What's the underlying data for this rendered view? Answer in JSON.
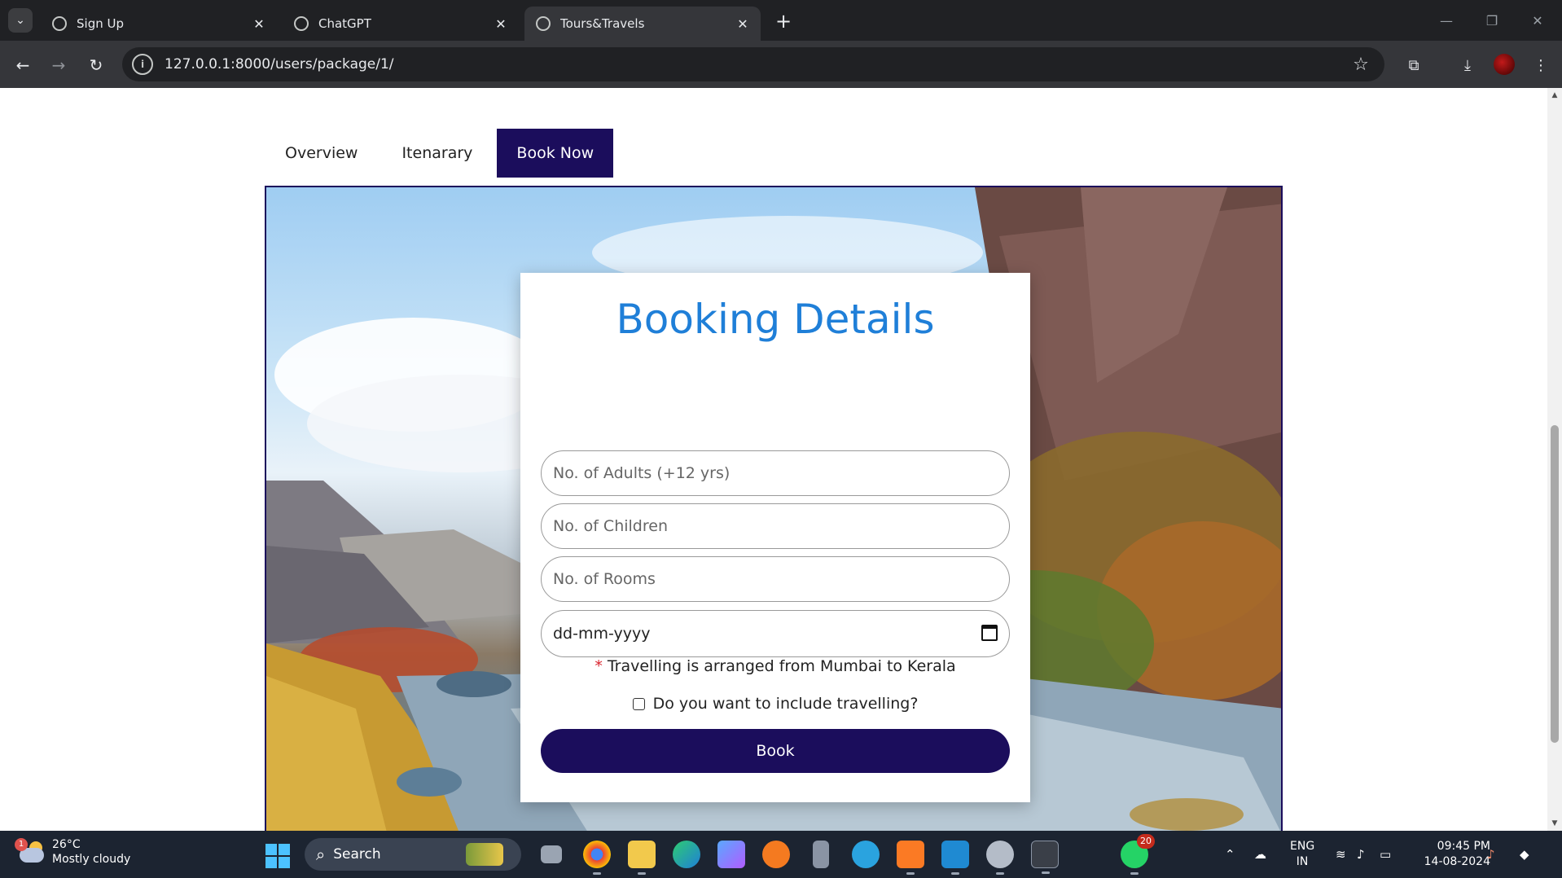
{
  "browser": {
    "tabs": [
      {
        "title": "Sign Up",
        "active": false
      },
      {
        "title": "ChatGPT",
        "active": false
      },
      {
        "title": "Tours&Travels",
        "active": true
      }
    ],
    "new_tab_icon": "plus-icon",
    "url": "127.0.0.1:8000/users/package/1/"
  },
  "page": {
    "tabs": [
      {
        "label": "Overview"
      },
      {
        "label": "Itenarary"
      },
      {
        "label": "Book Now"
      }
    ],
    "active_tab": "Book Now",
    "accent_color": "#1b0d5c",
    "booking": {
      "title": "Booking Details",
      "title_color": "#1f7fd8",
      "adults_placeholder": "No. of Adults (+12 yrs)",
      "children_placeholder": "No. of Children",
      "rooms_placeholder": "No. of Rooms",
      "date_placeholder": "dd-mm-yyyy",
      "note_marker": "*",
      "note": "Travelling is arranged from Mumbai to Kerala",
      "travel_checkbox_label": "Do you want to include travelling?",
      "travel_checked": false,
      "book_button": "Book"
    }
  },
  "taskbar": {
    "weather": {
      "badge": "1",
      "temp": "26°C",
      "condition": "Mostly cloudy"
    },
    "search_label": "Search",
    "apps": [
      "task-view",
      "chrome",
      "file-explorer",
      "edge",
      "copilot",
      "brave",
      "recorder",
      "telegram",
      "xampp",
      "vscode",
      "settings",
      "terminal",
      "whatsapp"
    ],
    "whatsapp_badge": "20",
    "lang_primary": "ENG",
    "lang_secondary": "IN",
    "time": "09:45 PM",
    "date": "14-08-2024"
  }
}
